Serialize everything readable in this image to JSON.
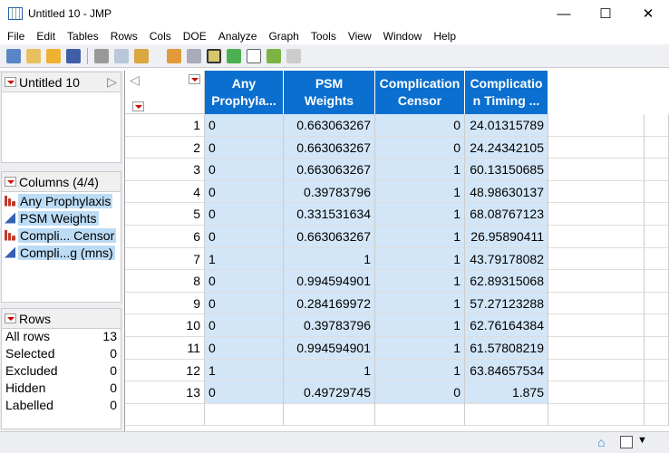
{
  "window": {
    "title": "Untitled 10 - JMP"
  },
  "menu": [
    "File",
    "Edit",
    "Tables",
    "Rows",
    "Cols",
    "DOE",
    "Analyze",
    "Graph",
    "Tools",
    "View",
    "Window",
    "Help"
  ],
  "table_panel": {
    "name": "Untitled 10"
  },
  "columns_panel": {
    "title": "Columns (4/4)",
    "items": [
      {
        "label": "Any Prophylaxis",
        "type": "nominal"
      },
      {
        "label": "PSM Weights",
        "type": "continuous"
      },
      {
        "label": "Compli... Censor",
        "type": "nominal"
      },
      {
        "label": "Compli...g (mns)",
        "type": "continuous"
      }
    ]
  },
  "rows_panel": {
    "title": "Rows",
    "stats": [
      {
        "label": "All rows",
        "value": "13"
      },
      {
        "label": "Selected",
        "value": "0"
      },
      {
        "label": "Excluded",
        "value": "0"
      },
      {
        "label": "Hidden",
        "value": "0"
      },
      {
        "label": "Labelled",
        "value": "0"
      }
    ]
  },
  "table": {
    "headers": [
      [
        "Any",
        "Prophyla..."
      ],
      [
        "PSM",
        "Weights"
      ],
      [
        "Complication",
        "Censor"
      ],
      [
        "Complicatio",
        "n Timing ..."
      ]
    ],
    "rows": [
      [
        "1",
        "0",
        "0.663063267",
        "0",
        "24.01315789"
      ],
      [
        "2",
        "0",
        "0.663063267",
        "0",
        "24.24342105"
      ],
      [
        "3",
        "0",
        "0.663063267",
        "1",
        "60.13150685"
      ],
      [
        "4",
        "0",
        "0.39783796",
        "1",
        "48.98630137"
      ],
      [
        "5",
        "0",
        "0.331531634",
        "1",
        "68.08767123"
      ],
      [
        "6",
        "0",
        "0.663063267",
        "1",
        "26.95890411"
      ],
      [
        "7",
        "1",
        "1",
        "1",
        "43.79178082"
      ],
      [
        "8",
        "0",
        "0.994594901",
        "1",
        "62.89315068"
      ],
      [
        "9",
        "0",
        "0.284169972",
        "1",
        "57.27123288"
      ],
      [
        "10",
        "0",
        "0.39783796",
        "1",
        "62.76164384"
      ],
      [
        "11",
        "0",
        "0.994594901",
        "1",
        "61.57808219"
      ],
      [
        "12",
        "1",
        "1",
        "1",
        "63.84657534"
      ],
      [
        "13",
        "0",
        "0.49729745",
        "0",
        "1.875"
      ]
    ]
  },
  "colors": {
    "header": "#0b6fcf",
    "cell": "#d2e6f7"
  }
}
